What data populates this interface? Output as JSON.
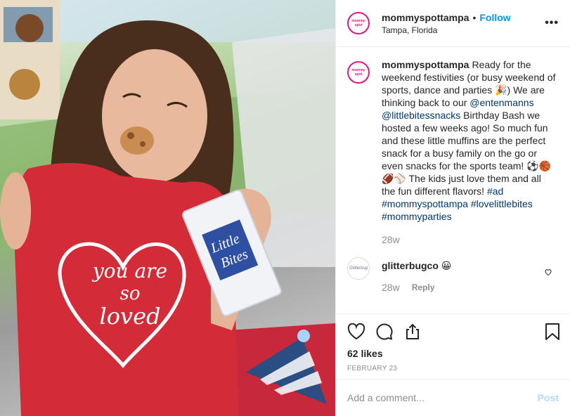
{
  "post": {
    "photo_shirt_text": [
      "you are",
      "so",
      "loved"
    ],
    "header": {
      "username": "mommyspottampa",
      "separator": "•",
      "follow_label": "Follow",
      "location": "Tampa, Florida",
      "more_icon": "ellipsis-icon"
    },
    "caption": {
      "username": "mommyspottampa",
      "text_1": "Ready for the weekend festivities (or busy weekend of sports, dance and parties 🎉) We are thinking back to our ",
      "mention_1": "@entenmanns",
      "mention_2": "@littlebitessnacks",
      "text_2": " Birthday Bash we hosted a few weeks ago! So much fun and these little muffins are the perfect snack for a busy family on the go or even snacks for the sports team! ⚽🏀🏈⚾ The kids just love them and all the fun different flavors! ",
      "hashtag_1": "#ad",
      "hashtag_2": "#mommyspottampa",
      "hashtag_3": "#lovelittlebites",
      "hashtag_4": "#mommyparties",
      "time_ago": "28w"
    },
    "comments": [
      {
        "username": "glitterbugco",
        "text": "😀",
        "time_ago": "28w",
        "reply_label": "Reply"
      }
    ],
    "actions": {
      "likes": "62 likes",
      "date": "FEBRUARY 23"
    },
    "add_comment": {
      "placeholder": "Add a comment...",
      "post_label": "Post"
    },
    "colors": {
      "brand": "#e0177e",
      "link_blue": "#0095f6",
      "muted": "#8e8e8e"
    }
  }
}
